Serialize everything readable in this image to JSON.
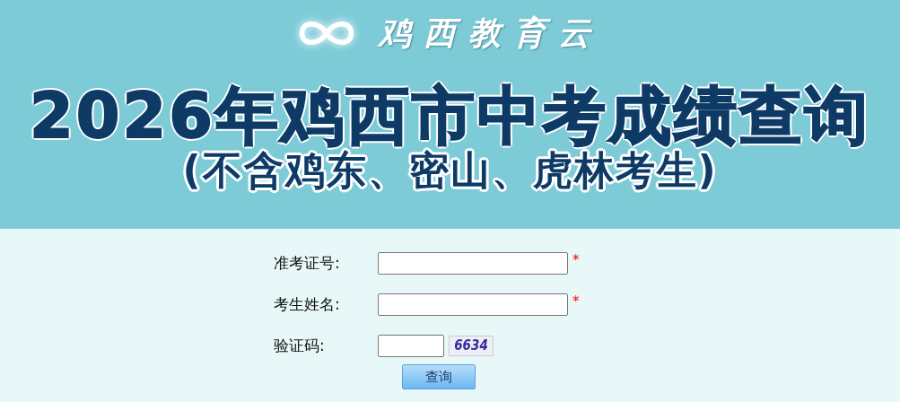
{
  "header": {
    "site_name": "鸡西教育云",
    "title": "2026年鸡西市中考成绩查询",
    "subtitle": "(不含鸡东、密山、虎林考生)"
  },
  "form": {
    "fields": [
      {
        "kind": "text",
        "label": "准考证号:",
        "required_mark": "*"
      },
      {
        "kind": "text",
        "label": "考生姓名:",
        "required_mark": "*"
      },
      {
        "kind": "captcha",
        "label": "验证码:",
        "captcha": "6634"
      }
    ],
    "submit": "查询"
  }
}
